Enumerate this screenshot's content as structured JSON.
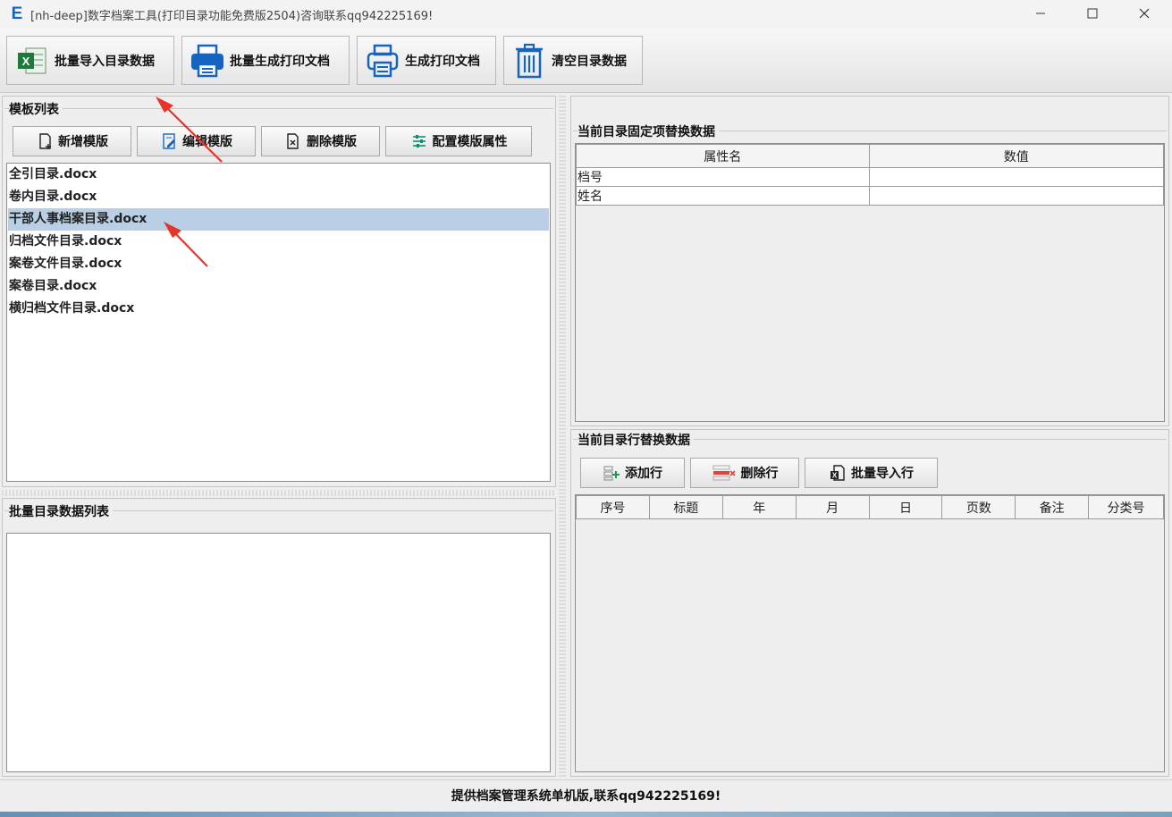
{
  "window": {
    "logo": "E",
    "title": "[nh-deep]数字档案工具(打印目录功能免费版2504)咨询联系qq942225169!"
  },
  "toolbar": {
    "import_label": "批量导入目录数据",
    "batch_print_label": "批量生成打印文档",
    "print_label": "生成打印文档",
    "clear_label": "清空目录数据"
  },
  "template_panel": {
    "title": "模板列表",
    "add_label": "新增模版",
    "edit_label": "编辑模版",
    "delete_label": "删除模版",
    "config_label": "配置模版属性",
    "items": [
      {
        "label": "全引目录.docx"
      },
      {
        "label": "卷内目录.docx"
      },
      {
        "label": "干部人事档案目录.docx"
      },
      {
        "label": "归档文件目录.docx"
      },
      {
        "label": "案卷文件目录.docx"
      },
      {
        "label": "案卷目录.docx"
      },
      {
        "label": "横归档文件目录.docx"
      }
    ],
    "selected_index": 2
  },
  "batch_panel": {
    "title": "批量目录数据列表"
  },
  "fixed_panel": {
    "title": "当前目录固定项替换数据",
    "columns": [
      "属性名",
      "数值"
    ],
    "rows": [
      {
        "name": "档号",
        "value": ""
      },
      {
        "name": "姓名",
        "value": ""
      }
    ]
  },
  "row_panel": {
    "title": "当前目录行替换数据",
    "add_row_label": "添加行",
    "delete_row_label": "删除行",
    "import_rows_label": "批量导入行",
    "columns": [
      "序号",
      "标题",
      "年",
      "月",
      "日",
      "页数",
      "备注",
      "分类号"
    ]
  },
  "status": {
    "text": "提供档案管理系统单机版,联系qq942225169!"
  },
  "colors": {
    "selection": "#b8cfe5",
    "annotation_arrow": "#e8332a",
    "excel_green": "#1e7a3c",
    "printer_blue": "#1565c0"
  }
}
